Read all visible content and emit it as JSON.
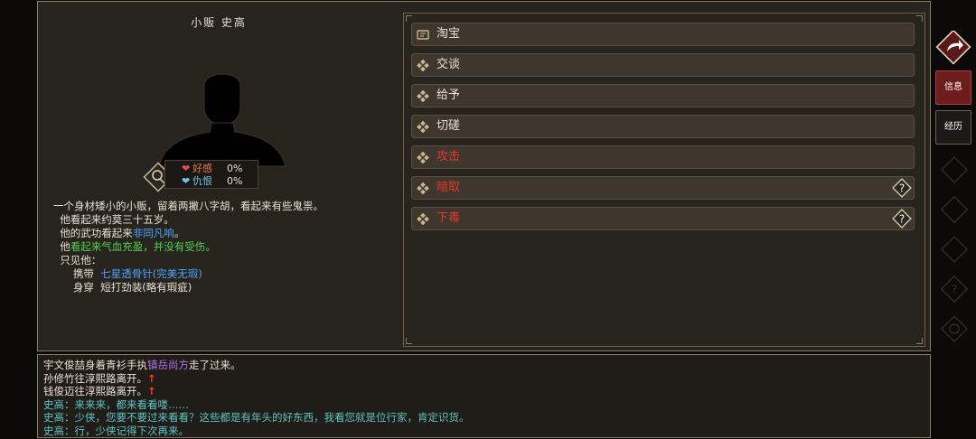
{
  "npc": {
    "name": "小贩 史高",
    "favor_label": "好感",
    "favor_value": "0%",
    "hatred_label": "仇恨",
    "hatred_value": "0%"
  },
  "description": {
    "line1": "一个身材矮小的小贩，留着两撇八字胡，看起来有些鬼祟。",
    "line2": "他看起来约莫三十五岁。",
    "line3_prefix": "他的武功看起来",
    "line3_value": "非同凡响",
    "line3_suffix": "。",
    "line4_prefix": "他",
    "line4_value": "看起来气血充盈，并没有受伤",
    "line4_suffix": "。",
    "line5": "只见他：",
    "carry_label": "携带",
    "carry_item": "七星透骨针",
    "carry_quality": "(完美无瑕)",
    "wear_label": "身穿",
    "wear_item": "短打劲装",
    "wear_quality": "(略有瑕疵)"
  },
  "actions": [
    {
      "label": "淘宝",
      "icon": "shop-icon"
    },
    {
      "label": "交谈",
      "icon": "diamond-icon"
    },
    {
      "label": "给予",
      "icon": "diamond-icon"
    },
    {
      "label": "切磋",
      "icon": "diamond-icon"
    },
    {
      "label": "攻击",
      "icon": "diamond-icon"
    },
    {
      "label": "暗取",
      "icon": "diamond-icon"
    },
    {
      "label": "下毒",
      "icon": "diamond-icon"
    }
  ],
  "log": {
    "l1_a": "宇文俊喆身着青衫手执",
    "l1_b": "镇岳尚方",
    "l1_c": "走了过来。",
    "l2": "孙修竹往淳熙路离开。",
    "l3": "钱俊迈往淳熙路离开。",
    "arrow": "↑",
    "l4": "史高：来来来，都来看看喽……",
    "l5": "史高：少侠，您要不要过来看看？这些都是有年头的好东西，我看您就是位行家，肯定识货。",
    "l6": "史高：行，少侠记得下次再来。"
  },
  "sidebar": {
    "info_label": "信息",
    "exp_label": "经历"
  },
  "colors": {
    "accent_red": "#e03a2a",
    "blue_text": "#4fa3ff",
    "green_text": "#52d152",
    "purple_text": "#b070f0",
    "teal_text": "#5cc4c4"
  }
}
